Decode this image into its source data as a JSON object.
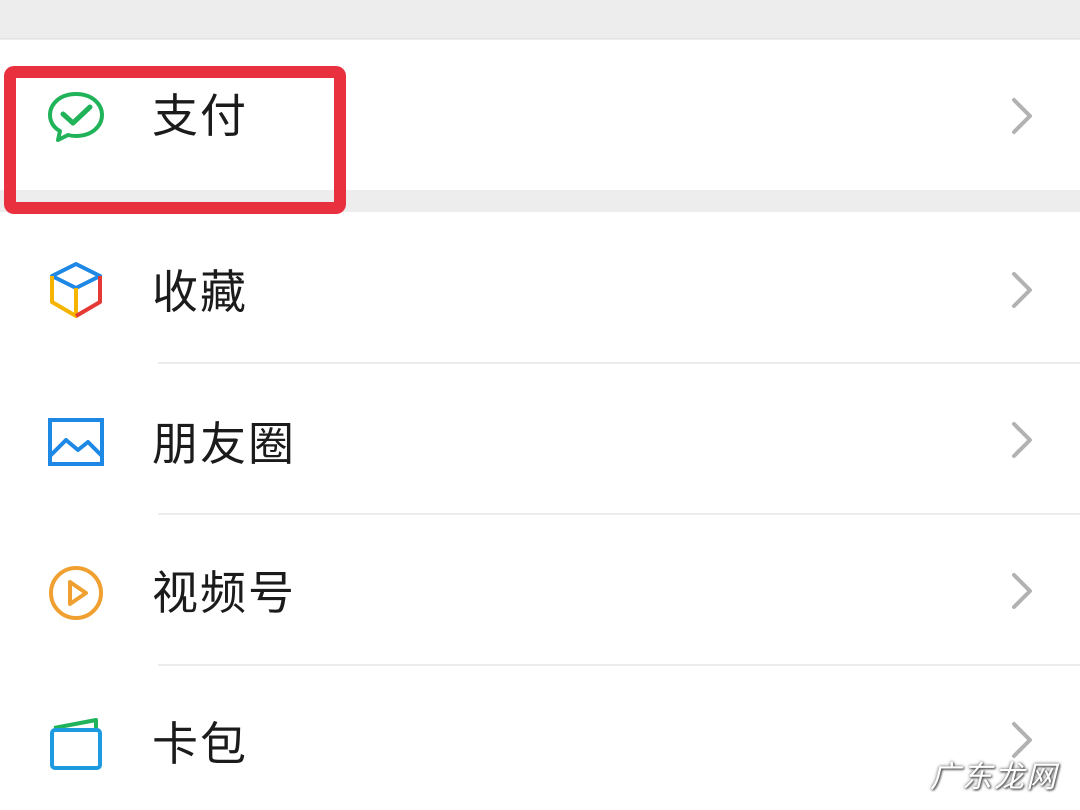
{
  "menu": {
    "items": [
      {
        "label": "支付",
        "icon": "wechat-pay-icon",
        "color": "#21b35a"
      },
      {
        "label": "收藏",
        "icon": "favorites-cube-icon",
        "color": "#f4b400"
      },
      {
        "label": "朋友圈",
        "icon": "moments-picture-icon",
        "color": "#1e88e5"
      },
      {
        "label": "视频号",
        "icon": "channels-play-icon",
        "color": "#f0a030"
      },
      {
        "label": "卡包",
        "icon": "card-wallet-icon",
        "color": "#1e9be0"
      }
    ]
  },
  "highlight": {
    "color": "#e8303e",
    "target": "支付"
  },
  "watermark": {
    "text": "广东龙网"
  }
}
